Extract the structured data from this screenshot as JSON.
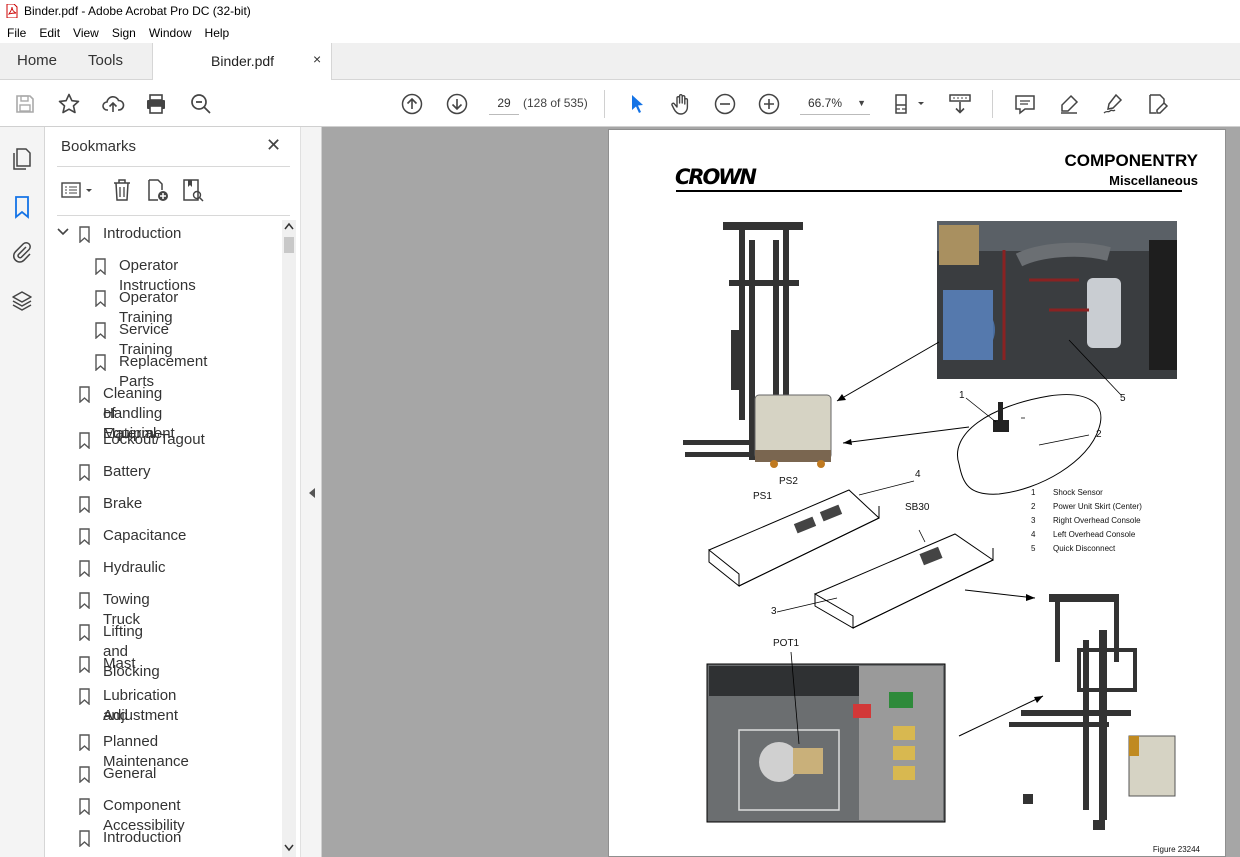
{
  "window": {
    "title": "Binder.pdf - Adobe Acrobat Pro DC (32-bit)"
  },
  "menu": [
    "File",
    "Edit",
    "View",
    "Sign",
    "Window",
    "Help"
  ],
  "tabs": {
    "home": "Home",
    "tools": "Tools",
    "document": "Binder.pdf",
    "close": "×"
  },
  "toolbar": {
    "page_number": "29",
    "page_count": "(128 of 535)",
    "zoom": "66.7%"
  },
  "bookmarks": {
    "title": "Bookmarks",
    "close": "✕",
    "items": [
      {
        "label": "Introduction"
      },
      {
        "label": "Operator Instructions"
      },
      {
        "label": "Operator Training"
      },
      {
        "label": "Service Training"
      },
      {
        "label": "Replacement Parts"
      },
      {
        "label": "Cleaning of Material"
      },
      {
        "label": "Handling Equipment"
      },
      {
        "label": "Lockout/Tagout"
      },
      {
        "label": "Battery"
      },
      {
        "label": "Brake"
      },
      {
        "label": "Capacitance"
      },
      {
        "label": "Hydraulic"
      },
      {
        "label": "Towing Truck"
      },
      {
        "label": "Lifting and Blocking"
      },
      {
        "label": "Mast"
      },
      {
        "label": "Lubrication and"
      },
      {
        "label": "Adjustment"
      },
      {
        "label": "Planned Maintenance"
      },
      {
        "label": "General"
      },
      {
        "label": "Component Accessibility"
      },
      {
        "label": "Introduction"
      }
    ]
  },
  "document": {
    "logo": "CROWN",
    "heading": "COMPONENTRY",
    "subheading": "Miscellaneous",
    "callouts": {
      "c1": "1",
      "c2": "2",
      "c3": "3",
      "c4": "4",
      "c5": "5",
      "ps1": "PS1",
      "ps2": "PS2",
      "sb30": "SB30",
      "pot1": "POT1"
    },
    "legend": [
      {
        "num": "1",
        "text": "Shock Sensor"
      },
      {
        "num": "2",
        "text": "Power Unit Skirt (Center)"
      },
      {
        "num": "3",
        "text": "Right Overhead Console"
      },
      {
        "num": "4",
        "text": "Left Overhead Console"
      },
      {
        "num": "5",
        "text": "Quick Disconnect"
      }
    ],
    "figure": "Figure 23244"
  },
  "colors": {
    "accent": "#1473e6",
    "toolbar_bg": "#f0f0f0",
    "doc_bg": "#a6a6a6"
  }
}
